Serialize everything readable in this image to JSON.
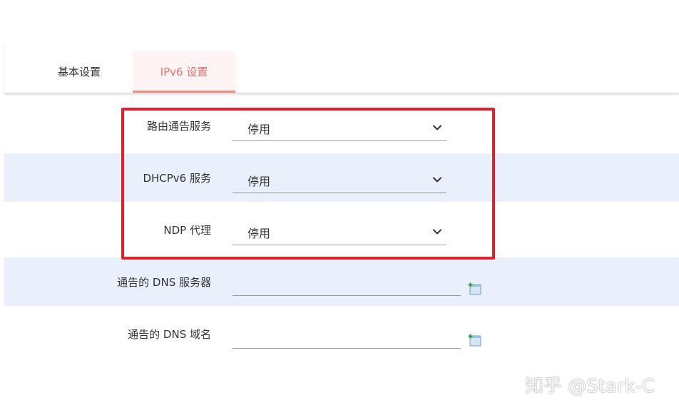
{
  "tabs": [
    {
      "label": "基本设置",
      "active": false
    },
    {
      "label": "IPv6 设置",
      "active": true
    }
  ],
  "fields": {
    "ra_service": {
      "label": "路由通告服务",
      "value": "停用"
    },
    "dhcpv6_service": {
      "label": "DHCPv6 服务",
      "value": "停用"
    },
    "ndp_proxy": {
      "label": "NDP 代理",
      "value": "停用"
    },
    "dns_servers": {
      "label": "通告的 DNS 服务器",
      "value": ""
    },
    "dns_domains": {
      "label": "通告的 DNS 域名",
      "value": ""
    }
  },
  "watermark": "知乎 @Stark-C",
  "colors": {
    "active_tab_text": "#e8706c",
    "active_tab_underline": "#f08b7f",
    "alt_row_bg": "#e9f0fb",
    "highlight_border": "#e0212b"
  }
}
